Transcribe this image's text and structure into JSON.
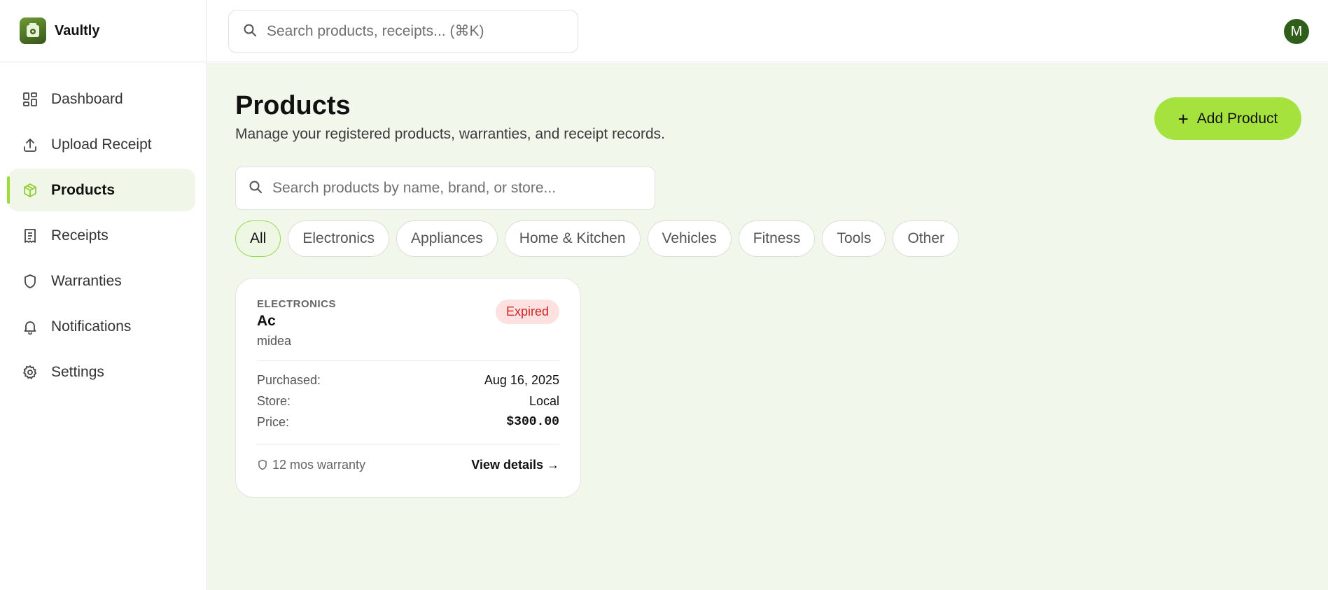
{
  "brand": {
    "name": "Vaultly"
  },
  "header": {
    "search_placeholder": "Search products, receipts... (⌘K)",
    "avatar_initial": "M"
  },
  "sidebar": {
    "items": [
      {
        "label": "Dashboard",
        "icon": "dashboard-icon",
        "active": false
      },
      {
        "label": "Upload Receipt",
        "icon": "upload-icon",
        "active": false
      },
      {
        "label": "Products",
        "icon": "box-icon",
        "active": true
      },
      {
        "label": "Receipts",
        "icon": "receipt-icon",
        "active": false
      },
      {
        "label": "Warranties",
        "icon": "shield-icon",
        "active": false
      },
      {
        "label": "Notifications",
        "icon": "bell-icon",
        "active": false
      },
      {
        "label": "Settings",
        "icon": "gear-icon",
        "active": false
      }
    ]
  },
  "main": {
    "title": "Products",
    "subtitle": "Manage your registered products, warranties, and receipt records.",
    "add_button": "Add Product",
    "search_placeholder": "Search products by name, brand, or store...",
    "filters": [
      "All",
      "Electronics",
      "Appliances",
      "Home & Kitchen",
      "Vehicles",
      "Fitness",
      "Tools",
      "Other"
    ],
    "active_filter": "All",
    "products": [
      {
        "category": "ELECTRONICS",
        "name": "Ac",
        "brand": "midea",
        "status": "Expired",
        "purchased_label": "Purchased:",
        "purchased": "Aug 16, 2025",
        "store_label": "Store:",
        "store": "Local",
        "price_label": "Price:",
        "price": "$300.00",
        "warranty": "12 mos warranty",
        "view_details": "View details →"
      }
    ]
  },
  "colors": {
    "accent": "#a5e23e",
    "main_bg": "#f2f7ec",
    "avatar_bg": "#2f5d1a",
    "expired_bg": "#fde1e1",
    "expired_text": "#d02525"
  }
}
